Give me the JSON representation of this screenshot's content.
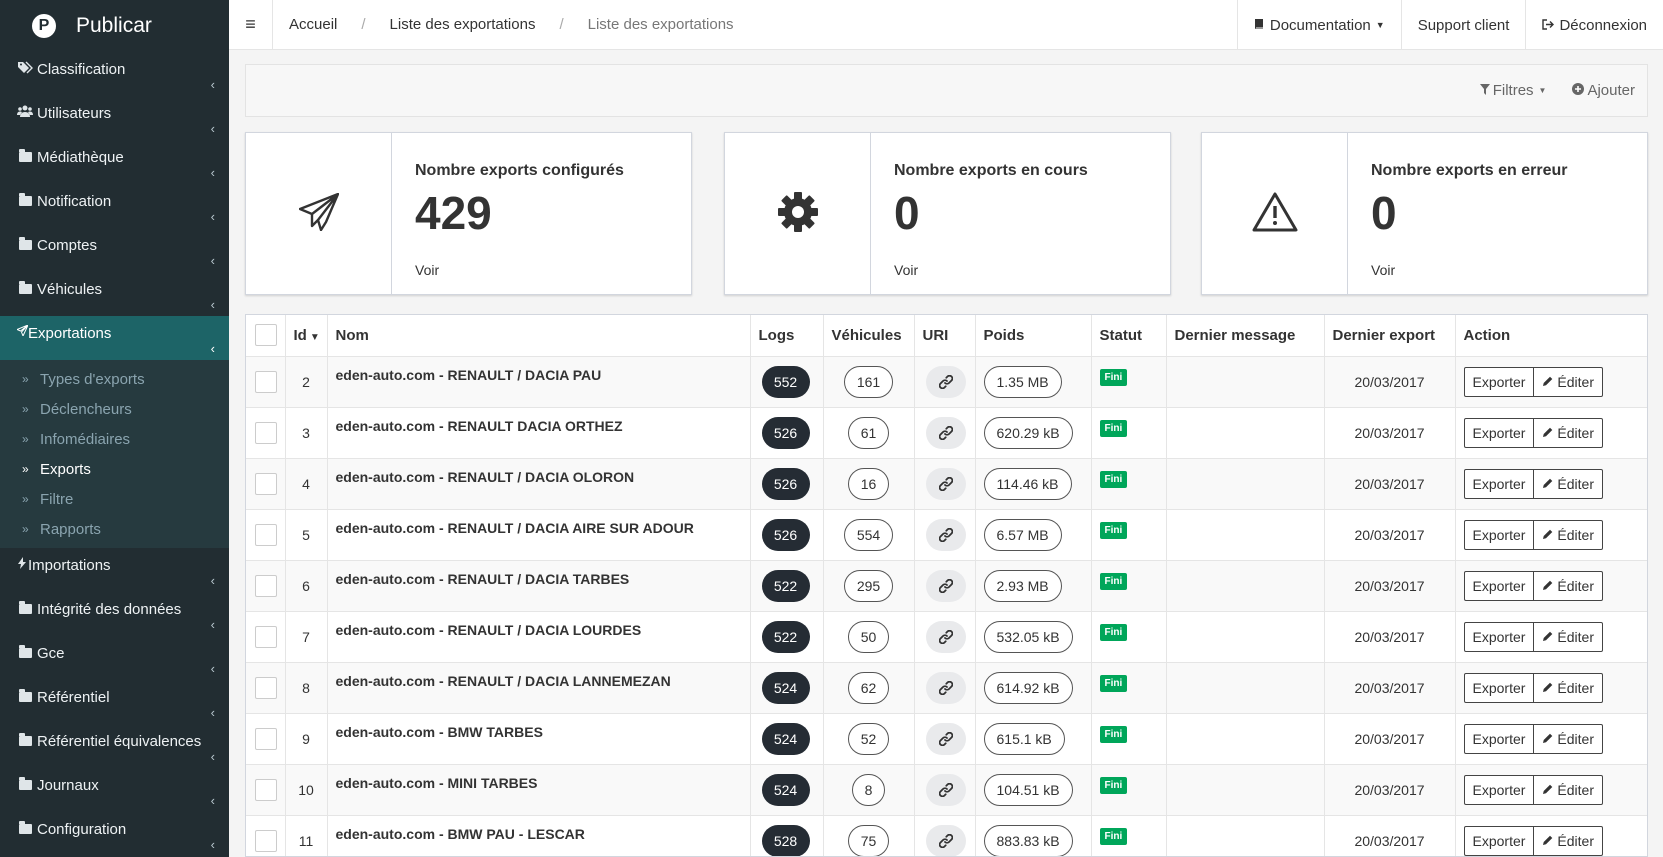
{
  "app": {
    "name": "Publicar",
    "logo_letter": "P"
  },
  "sidebar": {
    "items": [
      {
        "label": "Classification",
        "icon": "tags-icon"
      },
      {
        "label": "Utilisateurs",
        "icon": "users-icon"
      },
      {
        "label": "Médiathèque",
        "icon": "folder-icon"
      },
      {
        "label": "Notification",
        "icon": "folder-icon"
      },
      {
        "label": "Comptes",
        "icon": "folder-icon"
      },
      {
        "label": "Véhicules",
        "icon": "folder-icon"
      },
      {
        "label": "Exportations",
        "icon": "paper-plane-icon",
        "active": true
      },
      {
        "label": "Importations",
        "icon": "bolt-icon"
      },
      {
        "label": "Intégrité des données",
        "icon": "folder-icon"
      },
      {
        "label": "Gce",
        "icon": "folder-icon"
      },
      {
        "label": "Référentiel",
        "icon": "folder-icon"
      },
      {
        "label": "Référentiel équivalences",
        "icon": "folder-icon"
      },
      {
        "label": "Journaux",
        "icon": "folder-icon"
      },
      {
        "label": "Configuration",
        "icon": "folder-icon"
      }
    ],
    "submenu": [
      {
        "label": "Types d'exports"
      },
      {
        "label": "Déclencheurs"
      },
      {
        "label": "Infomédiaires"
      },
      {
        "label": "Exports",
        "current": true
      },
      {
        "label": "Filtre"
      },
      {
        "label": "Rapports"
      }
    ]
  },
  "topbar": {
    "breadcrumb": [
      "Accueil",
      "Liste des exportations",
      "Liste des exportations"
    ],
    "documentation": "Documentation",
    "support": "Support client",
    "logout": "Déconnexion"
  },
  "actionbar": {
    "filters": "Filtres",
    "add": "Ajouter"
  },
  "stats": [
    {
      "label": "Nombre exports configurés",
      "value": "429",
      "link": "Voir",
      "icon": "paper-plane-icon"
    },
    {
      "label": "Nombre exports en cours",
      "value": "0",
      "link": "Voir",
      "icon": "gear-icon"
    },
    {
      "label": "Nombre exports en erreur",
      "value": "0",
      "link": "Voir",
      "icon": "warning-icon"
    }
  ],
  "table": {
    "columns": {
      "id": "Id",
      "nom": "Nom",
      "logs": "Logs",
      "vehicules": "Véhicules",
      "uri": "URI",
      "poids": "Poids",
      "statut": "Statut",
      "dernier_message": "Dernier message",
      "dernier_export": "Dernier export",
      "action": "Action"
    },
    "export_label": "Exporter",
    "edit_label": "Éditer",
    "rows": [
      {
        "id": "2",
        "nom": "eden-auto.com - RENAULT / DACIA PAU",
        "logs": "552",
        "vehicules": "161",
        "poids": "1.35 MB",
        "statut": "Fini",
        "message": "",
        "date": "20/03/2017"
      },
      {
        "id": "3",
        "nom": "eden-auto.com - RENAULT DACIA ORTHEZ",
        "logs": "526",
        "vehicules": "61",
        "poids": "620.29 kB",
        "statut": "Fini",
        "message": "",
        "date": "20/03/2017"
      },
      {
        "id": "4",
        "nom": "eden-auto.com - RENAULT / DACIA OLORON",
        "logs": "526",
        "vehicules": "16",
        "poids": "114.46 kB",
        "statut": "Fini",
        "message": "",
        "date": "20/03/2017"
      },
      {
        "id": "5",
        "nom": "eden-auto.com - RENAULT / DACIA AIRE SUR ADOUR",
        "logs": "526",
        "vehicules": "554",
        "poids": "6.57 MB",
        "statut": "Fini",
        "message": "",
        "date": "20/03/2017"
      },
      {
        "id": "6",
        "nom": "eden-auto.com - RENAULT / DACIA TARBES",
        "logs": "522",
        "vehicules": "295",
        "poids": "2.93 MB",
        "statut": "Fini",
        "message": "",
        "date": "20/03/2017"
      },
      {
        "id": "7",
        "nom": "eden-auto.com - RENAULT / DACIA LOURDES",
        "logs": "522",
        "vehicules": "50",
        "poids": "532.05 kB",
        "statut": "Fini",
        "message": "",
        "date": "20/03/2017"
      },
      {
        "id": "8",
        "nom": "eden-auto.com - RENAULT / DACIA LANNEMEZAN",
        "logs": "524",
        "vehicules": "62",
        "poids": "614.92 kB",
        "statut": "Fini",
        "message": "",
        "date": "20/03/2017"
      },
      {
        "id": "9",
        "nom": "eden-auto.com - BMW TARBES",
        "logs": "524",
        "vehicules": "52",
        "poids": "615.1 kB",
        "statut": "Fini",
        "message": "",
        "date": "20/03/2017"
      },
      {
        "id": "10",
        "nom": "eden-auto.com - MINI TARBES",
        "logs": "524",
        "vehicules": "8",
        "poids": "104.51 kB",
        "statut": "Fini",
        "message": "",
        "date": "20/03/2017"
      },
      {
        "id": "11",
        "nom": "eden-auto.com - BMW PAU - LESCAR",
        "logs": "528",
        "vehicules": "75",
        "poids": "883.83 kB",
        "statut": "Fini",
        "message": "",
        "date": "20/03/2017"
      }
    ]
  },
  "colors": {
    "sidebar_bg": "#222d32",
    "active_bg": "#1d6467",
    "status_green": "#00a65a",
    "logs_pill": "#252c34"
  }
}
